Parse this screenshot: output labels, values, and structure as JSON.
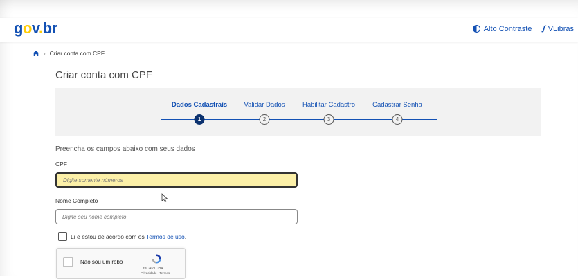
{
  "header": {
    "logo": {
      "g": "g",
      "o": "o",
      "v": "v",
      "dot": ".",
      "br": "br"
    },
    "contrast_label": "Alto Contraste",
    "vlibras_label": "VLibras"
  },
  "breadcrumb": {
    "separator": "›",
    "current": "Criar conta com CPF"
  },
  "page_title": "Criar conta com CPF",
  "stepper": {
    "steps": [
      {
        "label": "Dados Cadastrais",
        "number": "1",
        "active": true
      },
      {
        "label": "Validar Dados",
        "number": "2",
        "active": false
      },
      {
        "label": "Habilitar Cadastro",
        "number": "3",
        "active": false
      },
      {
        "label": "Cadastrar Senha",
        "number": "4",
        "active": false
      }
    ]
  },
  "form": {
    "instruction": "Preencha os campos abaixo com seus dados",
    "cpf_label": "CPF",
    "cpf_placeholder": "Digite somente números",
    "name_label": "Nome Completo",
    "name_placeholder": "Digite seu nome completo",
    "terms_prefix": "Li e estou de acordo com os ",
    "terms_link": "Termos de uso",
    "terms_suffix": "."
  },
  "captcha": {
    "label": "Não sou um robô",
    "brand": "reCAPTCHA",
    "links": "Privacidade - Termos"
  },
  "colors": {
    "brand_blue": "#1351b4",
    "brand_yellow": "#ffcd07",
    "focus_fill": "#fcf0a8",
    "active_step": "#0c326f"
  }
}
